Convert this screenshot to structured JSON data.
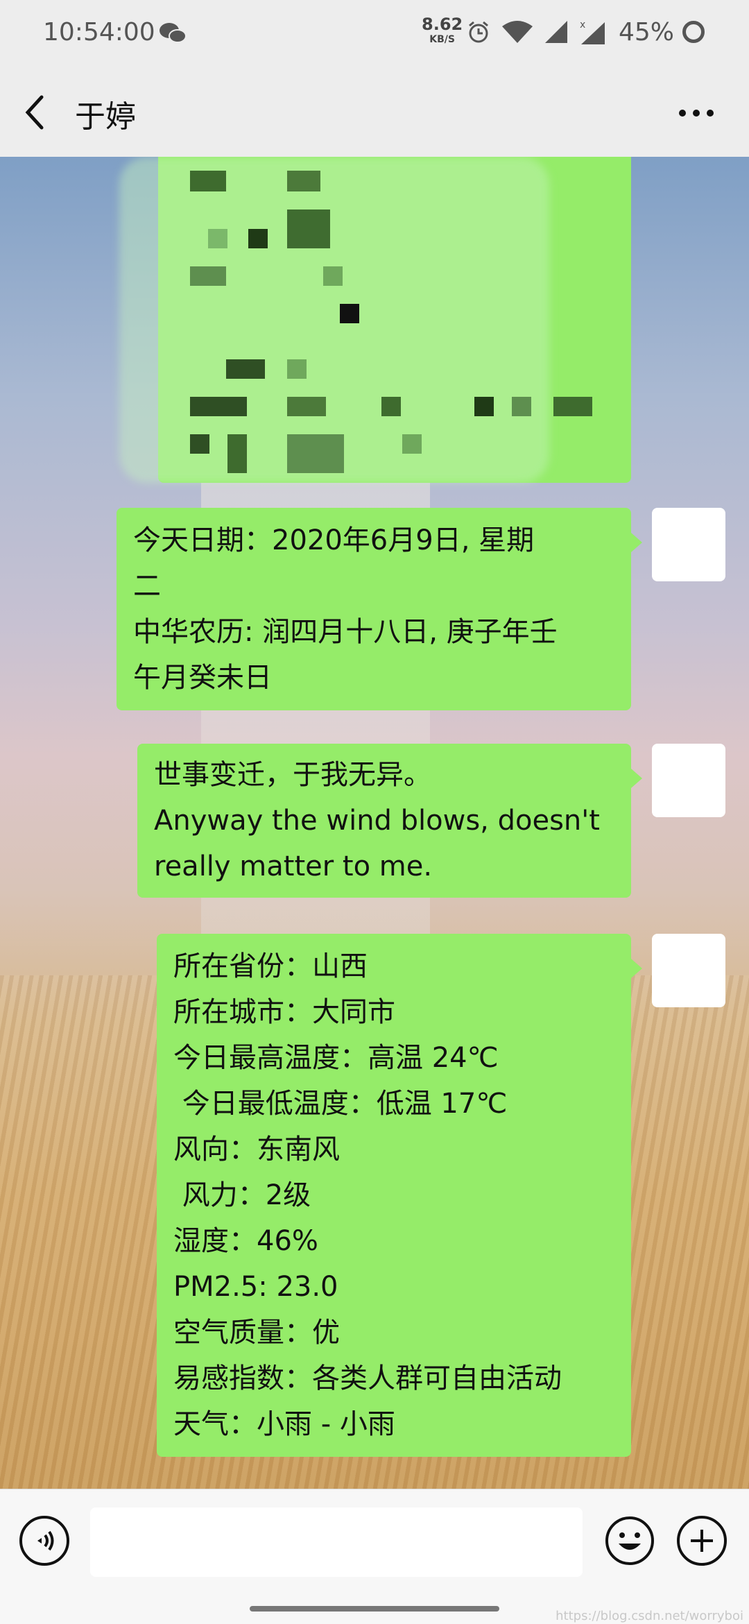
{
  "status_bar": {
    "time": "10:54:00",
    "net_speed_value": "8.62",
    "net_speed_unit": "KB/S",
    "battery": "45%"
  },
  "nav": {
    "title": "于婷",
    "back_icon": "chevron-left-icon",
    "more_icon": "more-dots-icon"
  },
  "messages": [
    {
      "lines": [
        "今天日期：2020年6月9日, 星期",
        "二",
        "中华农历: 润四月十八日, 庚子年壬",
        "午月癸未日"
      ]
    },
    {
      "lines": [
        "世事变迁，于我无异。",
        "Anyway the wind blows, doesn't",
        "really matter to me."
      ]
    },
    {
      "lines": [
        "所在省份：山西",
        "所在城市：大同市",
        "今日最高温度：高温 24℃",
        " 今日最低温度：低温 17℃",
        "风向：东南风",
        " 风力：2级",
        "湿度：46%",
        "PM2.5: 23.0",
        "空气质量：优",
        "易感指数：各类人群可自由活动",
        "天气：小雨 - 小雨"
      ]
    }
  ],
  "input_bar": {
    "voice_icon": "voice-icon",
    "emoji_icon": "emoji-icon",
    "plus_icon": "plus-icon"
  },
  "watermark": "https://blog.csdn.net/worryboi"
}
